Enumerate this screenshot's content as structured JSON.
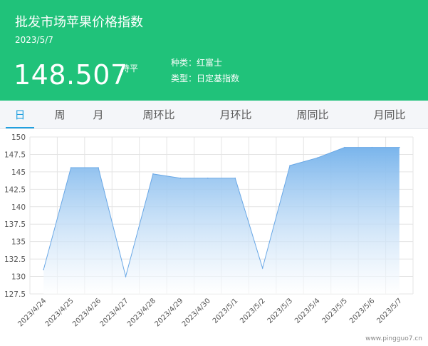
{
  "header": {
    "title": "批发市场苹果价格指数",
    "date": "2023/5/7",
    "price": "148.507",
    "change": "持平",
    "variety": "种类：红富士",
    "kind": "类型：日定基指数"
  },
  "tabs": [
    "日",
    "周",
    "月",
    "周环比",
    "月环比",
    "周同比",
    "月同比"
  ],
  "active_tab": "日",
  "watermark": "www.pingguo7.cn",
  "colors": {
    "header_bg": "#20c27a",
    "accent": "#20a0e0",
    "area_top": "#7ab5ec",
    "area_bottom": "#ffffff"
  },
  "chart_data": {
    "type": "area",
    "title": "",
    "xlabel": "",
    "ylabel": "",
    "categories": [
      "2023/4/24",
      "2023/4/25",
      "2023/4/26",
      "2023/4/27",
      "2023/4/28",
      "2023/4/29",
      "2023/4/30",
      "2023/5/1",
      "2023/5/2",
      "2023/5/3",
      "2023/5/4",
      "2023/5/5",
      "2023/5/6",
      "2023/5/7"
    ],
    "values": [
      131.0,
      145.6,
      145.6,
      130.0,
      144.7,
      144.1,
      144.1,
      144.1,
      131.2,
      145.9,
      147.0,
      148.5,
      148.5,
      148.5
    ],
    "ylim": [
      127.5,
      150
    ],
    "yticks": [
      "127.5",
      "130",
      "132.5",
      "135",
      "137.5",
      "140",
      "142.5",
      "145",
      "147.5",
      "150"
    ],
    "grid": true
  }
}
